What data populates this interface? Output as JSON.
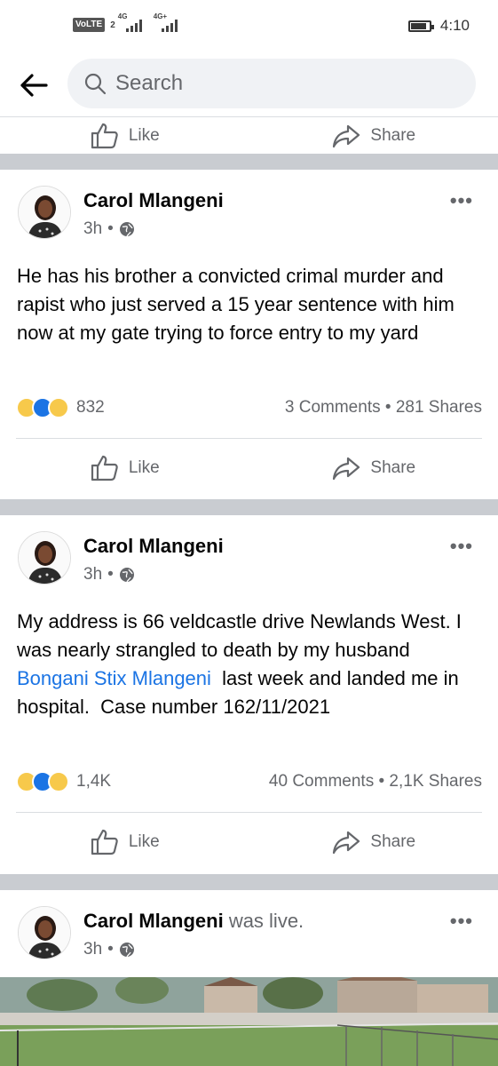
{
  "status_bar": {
    "volte": "VoLTE",
    "sim": "2",
    "net1": "4G",
    "net2": "4G+",
    "time": "4:10"
  },
  "search": {
    "placeholder": "Search"
  },
  "actions": {
    "like": "Like",
    "share": "Share"
  },
  "posts": [
    {
      "author": "Carol Mlangeni",
      "time": "3h",
      "text": "He has his brother a convicted crimal murder and rapist who just served a 15 year sentence with him now at my gate trying to force entry to my yard",
      "reactions": [
        "sad",
        "like",
        "wow"
      ],
      "reaction_count": "832",
      "comments": "3 Comments",
      "shares": "281 Shares"
    },
    {
      "author": "Carol Mlangeni",
      "time": "3h",
      "text_before": "My address is 66 veldcastle drive Newlands West. I was nearly strangled to death by my husband ",
      "mention": "Bongani Stix Mlangeni",
      "text_after": "  last week and landed me in hospital.  Case number 162/11/2021",
      "reactions": [
        "sad",
        "like",
        "wow"
      ],
      "reaction_count": "1,4K",
      "comments": "40 Comments",
      "shares": "2,1K Shares"
    },
    {
      "author": "Carol Mlangeni",
      "suffix": "was live.",
      "time": "3h"
    }
  ],
  "icons": {
    "back": "arrow-left-icon",
    "search": "search-icon",
    "privacy": "globe-icon",
    "more": "more-horizontal-icon",
    "like": "thumbs-up-icon",
    "share": "share-arrow-icon"
  },
  "colors": {
    "link": "#1b74e4",
    "divider": "#c9ccd1",
    "search_bg": "#f0f2f5"
  }
}
